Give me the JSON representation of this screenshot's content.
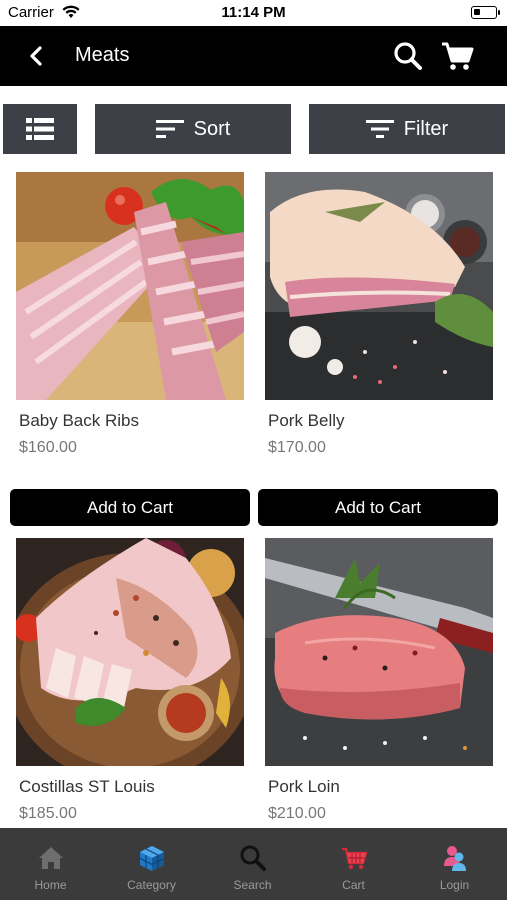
{
  "status_bar": {
    "carrier": "Carrier",
    "time": "11:14 PM"
  },
  "header": {
    "title": "Meats"
  },
  "toolbar": {
    "sort_label": "Sort",
    "filter_label": "Filter"
  },
  "products": [
    {
      "name": "Baby Back Ribs",
      "price": "$160.00",
      "button": "Add to Cart"
    },
    {
      "name": "Pork Belly",
      "price": "$170.00",
      "button": "Add to Cart"
    },
    {
      "name": "Costillas ST Louis",
      "price": "$185.00"
    },
    {
      "name": "Pork Loin",
      "price": "$210.00"
    }
  ],
  "tabs": [
    {
      "label": "Home",
      "icon": "home-icon"
    },
    {
      "label": "Category",
      "icon": "cube-icon"
    },
    {
      "label": "Search",
      "icon": "search-icon"
    },
    {
      "label": "Cart",
      "icon": "cart-icon"
    },
    {
      "label": "Login",
      "icon": "user-icon"
    }
  ],
  "colors": {
    "nav_background": "#000000",
    "toolbar_button": "#3d4046",
    "tab_bar": "#3b3b3b",
    "add_button": "#000000"
  }
}
